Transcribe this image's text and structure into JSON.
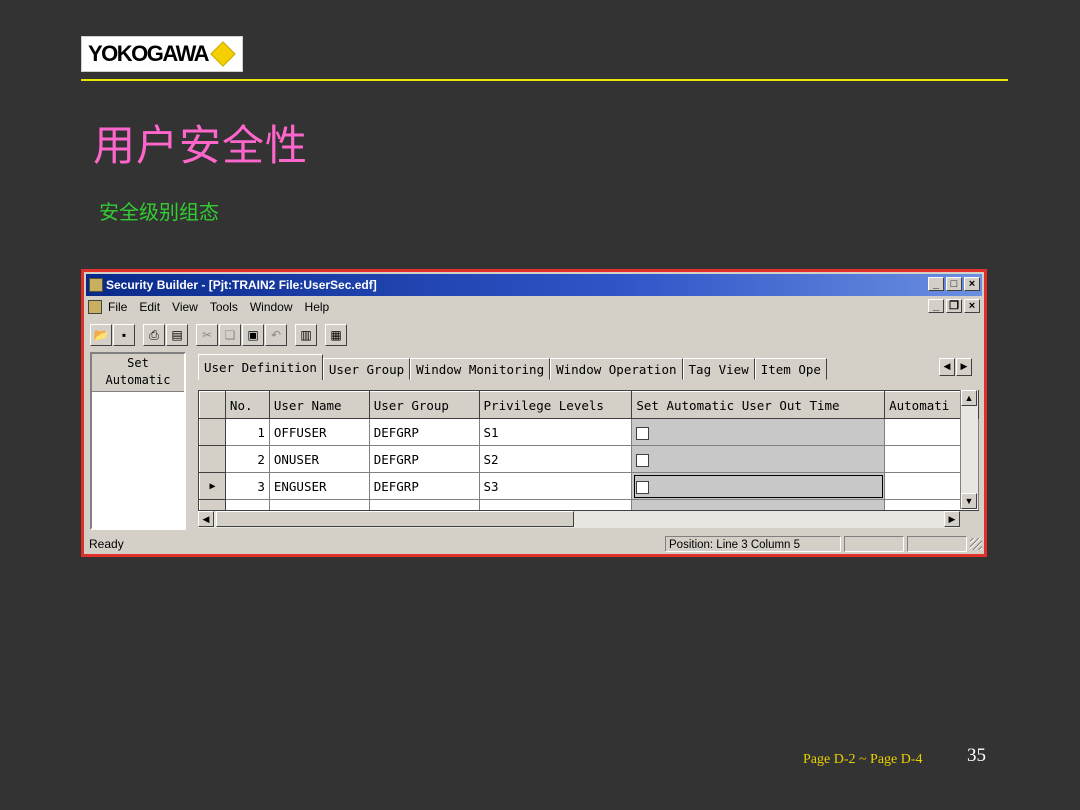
{
  "slide": {
    "logo_text": "YOKOGAWA",
    "title": "用户安全性",
    "subtitle": "安全级别组态",
    "page_ref": "Page D-2 ~ Page D-4",
    "page_number": "35",
    "colors": {
      "title": "#ff66cc",
      "subtitle": "#33cc33",
      "rule": "#e6e600",
      "background": "#333333"
    }
  },
  "window": {
    "title": "Security Builder - [Pjt:TRAIN2 File:UserSec.edf]",
    "menu": [
      "File",
      "Edit",
      "View",
      "Tools",
      "Window",
      "Help"
    ],
    "toolbar_icons": [
      "open-icon",
      "save-icon",
      "print-icon",
      "print-preview-icon",
      "cut-icon",
      "copy-icon",
      "paste-icon",
      "undo-icon",
      "window-icon-1",
      "window-icon-2"
    ],
    "left_pane_header": [
      "Set",
      "Automatic"
    ],
    "tabs": [
      "User Definition",
      "User Group",
      "Window Monitoring",
      "Window Operation",
      "Tag View",
      "Item Ope"
    ],
    "active_tab": 0,
    "table": {
      "columns": [
        "No.",
        "User Name",
        "User Group",
        "Privilege Levels",
        "Set Automatic User Out Time",
        "Automati"
      ],
      "rows": [
        {
          "no": "1",
          "user_name": "OFFUSER",
          "user_group": "DEFGRP",
          "privilege": "S1",
          "auto_out": false
        },
        {
          "no": "2",
          "user_name": "ONUSER",
          "user_group": "DEFGRP",
          "privilege": "S2",
          "auto_out": false
        },
        {
          "no": "3",
          "user_name": "ENGUSER",
          "user_group": "DEFGRP",
          "privilege": "S3",
          "auto_out": false
        }
      ],
      "current_row": 2
    },
    "status": {
      "text": "Ready",
      "position": "Position: Line   3 Column  5"
    }
  }
}
